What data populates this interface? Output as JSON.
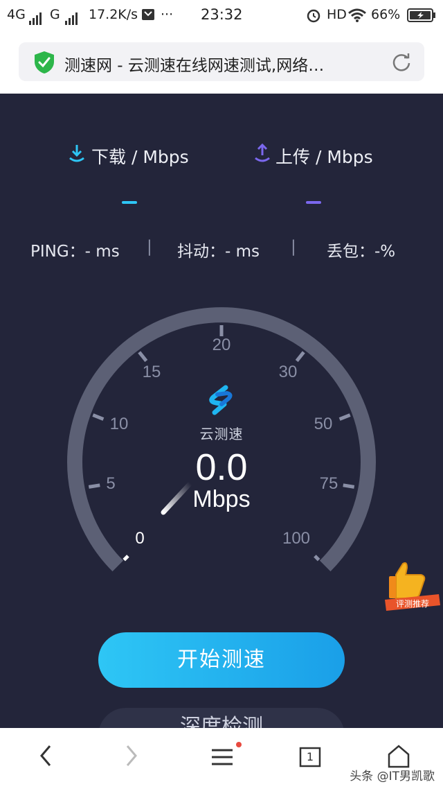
{
  "status_bar": {
    "network_1": "4G",
    "network_2": "G",
    "speed": "17.2K/s",
    "more": "···",
    "time": "23:32",
    "hd": "HD",
    "battery": "66%"
  },
  "address_bar": {
    "title": "测速网 - 云测速在线网速测试,网络…",
    "icons": [
      "shield-check-icon",
      "reload-icon"
    ]
  },
  "speed_test": {
    "download_label": "下载 / Mbps",
    "upload_label": "上传 / Mbps",
    "ping": "PING：- ms",
    "jitter": "抖动：- ms",
    "loss": "丢包：-%",
    "sep": "|",
    "gauge_ticks": [
      "0",
      "5",
      "10",
      "15",
      "20",
      "30",
      "50",
      "75",
      "100"
    ],
    "logo_text": "云测速",
    "speed_value": "0.0",
    "speed_unit": "Mbps",
    "start_button": "开始测速",
    "second_button": "深度检测",
    "badge_text": "评测推荐"
  },
  "colors": {
    "download": "#2ec6f5",
    "upload": "#7b68ee",
    "background": "#23253a",
    "gauge_track": "#5c6075"
  },
  "bottom_nav": {
    "tab_count": "1",
    "icons": [
      "back-icon",
      "forward-icon",
      "menu-icon",
      "tabs-icon",
      "home-icon"
    ]
  },
  "watermark": "头条 @IT男凯歌"
}
